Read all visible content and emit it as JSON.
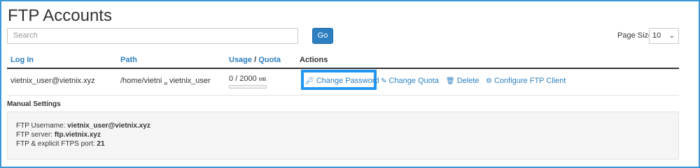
{
  "page": {
    "title": "FTP Accounts"
  },
  "search": {
    "placeholder": "Search",
    "go_label": "Go"
  },
  "page_size": {
    "label": "Page Size",
    "value": "10"
  },
  "table": {
    "headers": {
      "login": "Log In",
      "path": "Path",
      "usage": "Usage",
      "slash": "/",
      "quota": "Quota",
      "actions": "Actions"
    },
    "row": {
      "login": "vietnix_user@vietnix.xyz",
      "path_start": "/home/vietni",
      "path_ellipsis": "...",
      "path_end": "vietnix_user",
      "usage_text": "0 / 2000",
      "usage_unit": "MB",
      "usage_fraction": 0
    },
    "actions": {
      "change_password": "Change Password",
      "change_quota": "Change Quota",
      "delete": "Delete",
      "configure": "Configure FTP Client"
    }
  },
  "manual": {
    "title": "Manual Settings",
    "username_label": "FTP Username:",
    "username_value": "vietnix_user@vietnix.xyz",
    "server_label": "FTP server:",
    "server_value": "ftp.vietnix.xyz",
    "port_label": "FTP & explicit FTPS port:",
    "port_value": "21"
  },
  "colors": {
    "accent": "#2d7fc1",
    "highlight": "#2196f3",
    "frame": "#3a9ad9"
  },
  "icons": [
    "key-icon",
    "pencil-icon",
    "trash-icon",
    "gear-icon",
    "chevron-down-icon"
  ]
}
